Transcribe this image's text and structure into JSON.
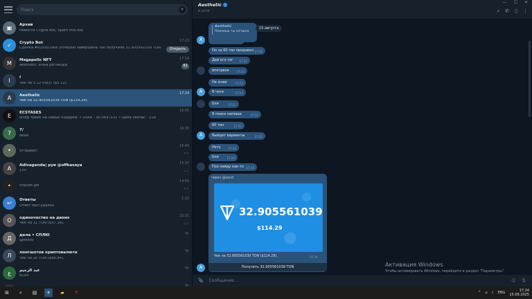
{
  "sidebar": {
    "search_placeholder": "Поиск",
    "chats": [
      {
        "name": "Архив",
        "preview": "Новости Crypto Bot, Spam Info Bot",
        "time": "",
        "color": "#5a6b7c",
        "icon": "▣"
      },
      {
        "name": "Crypto Bot",
        "preview": "Сделка #029301906 успешно завершена. Вы получили 32.905561039 TON.",
        "time": "17:23",
        "color": "#2e8fd8",
        "icon": "✓",
        "button": "Открыть"
      },
      {
        "name": "Megapolic NFT",
        "preview": "Aesthetic: Инна ратницка",
        "time": "17:24",
        "color": "#333",
        "icon": "M",
        "badge": "62"
      },
      {
        "name": "I",
        "preview": "Чек на 5.12 USDT ($5.12).",
        "time": "",
        "color": "#2a3a4f",
        "icon": "I"
      },
      {
        "name": "Aesthetic",
        "preview": "Чек на 32.905561039 TON ($114.29).",
        "time": "17:24",
        "color": "#2a3a4f",
        "icon": "A",
        "active": true
      },
      {
        "name": "ECSTASES",
        "preview": "Флор трейс на новые подарки: • Очки - 30.069 /131 • Цена сейчас - 219",
        "time": "16:55",
        "color": "#111",
        "icon": "E"
      },
      {
        "name": "7/",
        "preview": "окей",
        "time": "16:30",
        "color": "#3a6a4a",
        "icon": "7"
      },
      {
        "name": "",
        "preview": "отправил",
        "time": "16:44",
        "color": "#5a6a5a",
        "icon": "•",
        "check": "✓✓"
      },
      {
        "name": "Adivaganda| руи @offkasaya",
        "preview": "130",
        "time": "15:37",
        "color": "#444",
        "icon": "A",
        "check": "✓✓"
      },
      {
        "name": "",
        "preview": "спасиб дм",
        "time": "14:56",
        "color": "#222",
        "icon": "•",
        "check": "✓✓"
      },
      {
        "name": "Ответы",
        "preview": "Ответ был удален",
        "time": "1:22",
        "color": "#3a7fd0",
        "icon": "↩"
      },
      {
        "name": "одиночество на двоих",
        "preview": "Чек на 11 TON ($37.18).",
        "time": "22:21",
        "color": "#555",
        "icon": "О",
        "check": "✓✓"
      },
      {
        "name": "дела • СПЛЮ",
        "preview": "@eestsi",
        "time": "Чт",
        "color": "#666",
        "icon": "Д"
      },
      {
        "name": "лонгшотов криптовалюта",
        "preview": "Чек на 20 TON ($68.84).",
        "time": "Чт",
        "color": "#3a4a5a",
        "icon": "Л"
      },
      {
        "name": "عبد الرحيم",
        "preview": "919+",
        "time": "Чт",
        "color": "#2a6a3a",
        "icon": "ع"
      },
      {
        "name": "ремайком",
        "preview": "",
        "time": "Чт",
        "color": "#333",
        "icon": "р"
      }
    ]
  },
  "header": {
    "title": "Aesthetic",
    "status": "в сети"
  },
  "messages": [
    {
      "text": "Да",
      "time": "17:22",
      "side": "in"
    },
    {
      "text": "Он за 60 тон продавал",
      "time": "17:22",
      "side": "in"
    },
    {
      "text": "Дай его тег",
      "time": "17:22",
      "side": "in"
    },
    {
      "text": "ипотрвоя",
      "time": "17:22",
      "side": "in"
    },
    {
      "text": "Не знаю",
      "time": "17:22",
      "side": "in"
    },
    {
      "text": "В чате",
      "time": "17:22",
      "side": "in"
    },
    {
      "text": "Бля",
      "time": "17:22",
      "side": "in"
    },
    {
      "text": "В поиск напиши",
      "time": "17:22",
      "side": "in"
    },
    {
      "text": "60 тон",
      "time": "17:22",
      "side": "in"
    },
    {
      "text": "Выйдет варианты",
      "time": "17:22",
      "side": "in"
    },
    {
      "text": "Нету",
      "time": "17:23",
      "side": "in"
    },
    {
      "text": "Бля",
      "time": "17:23",
      "side": "in"
    },
    {
      "text": "Пох найду как-то",
      "time": "17:23",
      "side": "in"
    }
  ],
  "reply_preview": {
    "name": "Aesthetic",
    "text": "Помнишь ты сегодня"
  },
  "date_pill": "15 августа",
  "check_card": {
    "via": "через @send",
    "amount": "32.905561039",
    "usd": "$114.29",
    "caption": "Чек на 32.905561039 TON ($114.29).",
    "time": "17:24",
    "button": "Получить 32.905561039 TON"
  },
  "composer": {
    "placeholder": "Сообщение..."
  },
  "watermark": {
    "title": "Активация Windows",
    "text": "Чтобы активировать Windows, перейдите в раздел \"Параметры\"."
  },
  "taskbar": {
    "lang": "ENG",
    "time": "17:24",
    "date": "15.08.2025"
  }
}
